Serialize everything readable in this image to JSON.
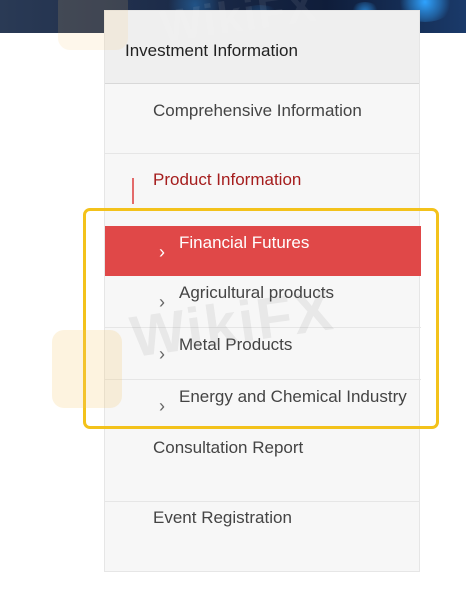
{
  "sidebar": {
    "header": "Investment Information",
    "items": [
      {
        "label": "Comprehensive Information"
      },
      {
        "label": "Product Information"
      }
    ],
    "sub_items": [
      {
        "label": "Financial Futures",
        "icon": "chevron-right-icon"
      },
      {
        "label": "Agricultural products",
        "icon": "chevron-right-icon"
      },
      {
        "label": "Metal Products",
        "icon": "chevron-right-icon"
      },
      {
        "label": "Energy and Chemical Industry",
        "icon": "chevron-right-icon"
      }
    ],
    "bottom_items": [
      {
        "label": "Consultation Report"
      },
      {
        "label": "Event Registration"
      }
    ]
  },
  "watermark": {
    "text": "WikiFX"
  },
  "chevron": "›",
  "colors": {
    "active": "#e04848",
    "product_label": "#a51d1d",
    "highlight": "#f3c21b",
    "sidebar_bg": "#f7f7f7"
  }
}
